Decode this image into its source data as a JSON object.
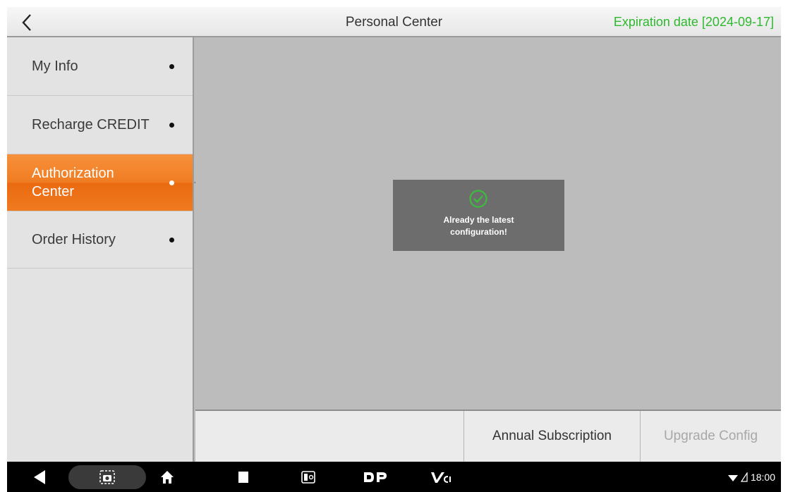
{
  "header": {
    "title": "Personal Center",
    "expiration": "Expiration date [2024-09-17]",
    "expiration_color": "#2eb82e"
  },
  "sidebar": {
    "items": [
      {
        "label": "My Info",
        "active": false
      },
      {
        "label": "Recharge CREDIT",
        "active": false
      },
      {
        "label": "Authorization Center",
        "active": true
      },
      {
        "label": "Order History",
        "active": false
      }
    ],
    "active_color": "#f07c22"
  },
  "toast": {
    "icon": "check-circle-icon",
    "message": "Already the latest configuration!"
  },
  "buttons": {
    "annual": "Annual Subscription",
    "upgrade": "Upgrade Config"
  },
  "navbar": {
    "icons": [
      "back-triangle-icon",
      "screenshot-camera-icon",
      "home-icon",
      "recent-apps-icon",
      "app-icon",
      "dp-logo-icon",
      "vci-logo-icon"
    ],
    "time": "18:00"
  }
}
